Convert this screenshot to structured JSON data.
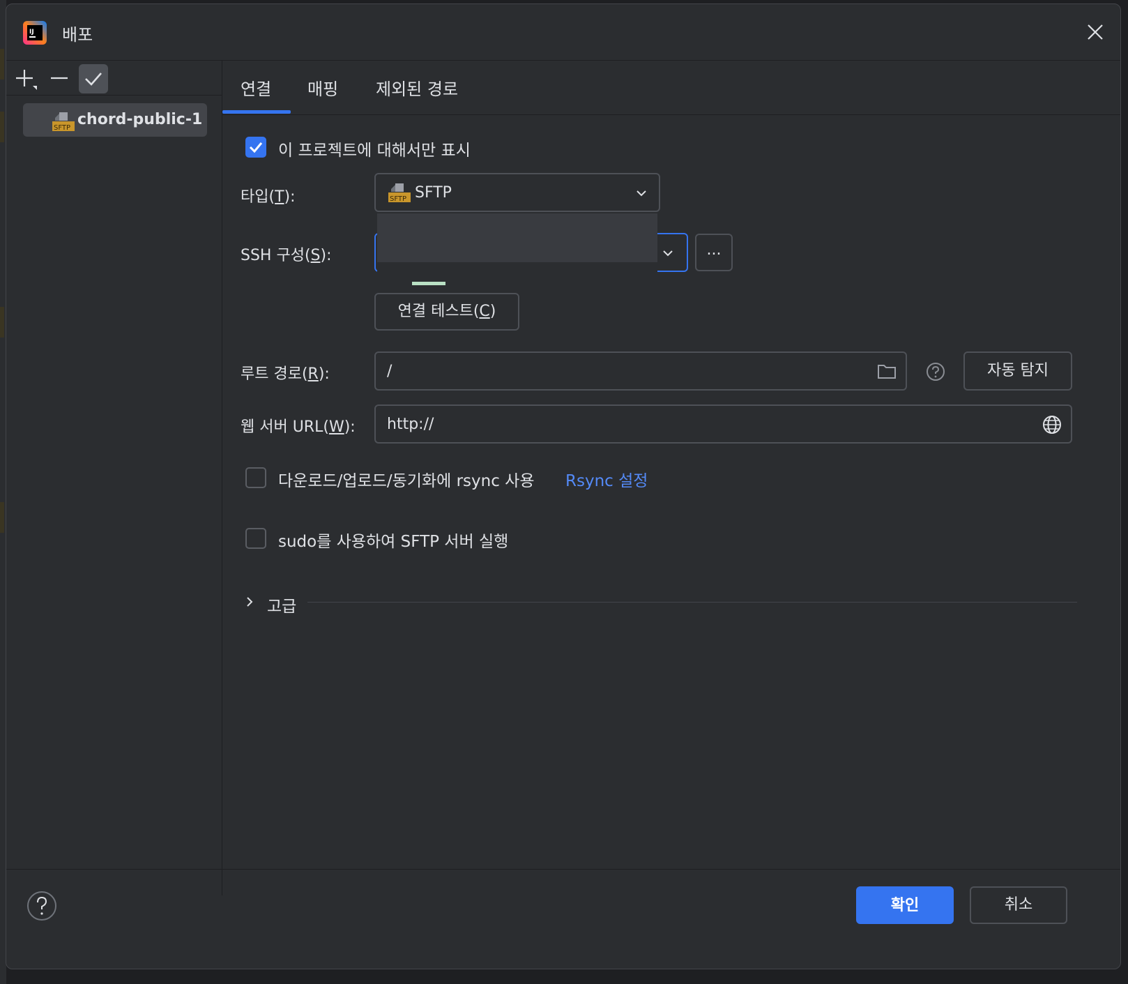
{
  "window": {
    "title": "배포",
    "icon": "intellij-app-icon",
    "close_icon": "close-icon"
  },
  "sidebar": {
    "toolbar": {
      "add_icon": "add-icon",
      "remove_icon": "remove-icon",
      "default_icon": "check-icon"
    },
    "servers": [
      {
        "label": "chord-public-1",
        "icon": "sftp-icon"
      }
    ]
  },
  "tabs": [
    {
      "label": "연결",
      "selected": true
    },
    {
      "label": "매핑",
      "selected": false
    },
    {
      "label": "제외된 경로",
      "selected": false
    }
  ],
  "connection": {
    "visible_only_project": {
      "label": "이 프로젝트에 대해서만 표시",
      "checked": true
    },
    "type": {
      "label_prefix": "타입(",
      "mnemonic": "T",
      "label_suffix": "):",
      "value": "SFTP"
    },
    "ssh_config": {
      "label_prefix": "SSH 구성(",
      "mnemonic": "S",
      "label_suffix": "):",
      "value": "",
      "more_button": "..."
    },
    "test_connection": {
      "label_prefix": "연결 테스트(",
      "mnemonic": "C",
      "label_suffix": ")"
    },
    "root_path": {
      "label_prefix": "루트 경로(",
      "mnemonic": "R",
      "label_suffix": "):",
      "value": "/",
      "autodetect_button": "자동 탐지"
    },
    "web_server_url": {
      "label_prefix": "웹 서버 URL(",
      "mnemonic": "W",
      "label_suffix": "):",
      "value": "http://"
    },
    "rsync": {
      "label": "다운로드/업로드/동기화에 rsync 사용",
      "checked": false,
      "settings_link": "Rsync 설정"
    },
    "sudo": {
      "label": "sudo를 사용하여 SFTP 서버 실행",
      "checked": false
    },
    "advanced": {
      "label": "고급",
      "expanded": false
    }
  },
  "footer": {
    "help_icon": "help-icon",
    "ok_button": "확인",
    "cancel_button": "취소"
  },
  "colors": {
    "accent": "#3574f0",
    "link": "#548af7",
    "background": "#2b2d30",
    "sftp_icon": "#c9962b"
  }
}
